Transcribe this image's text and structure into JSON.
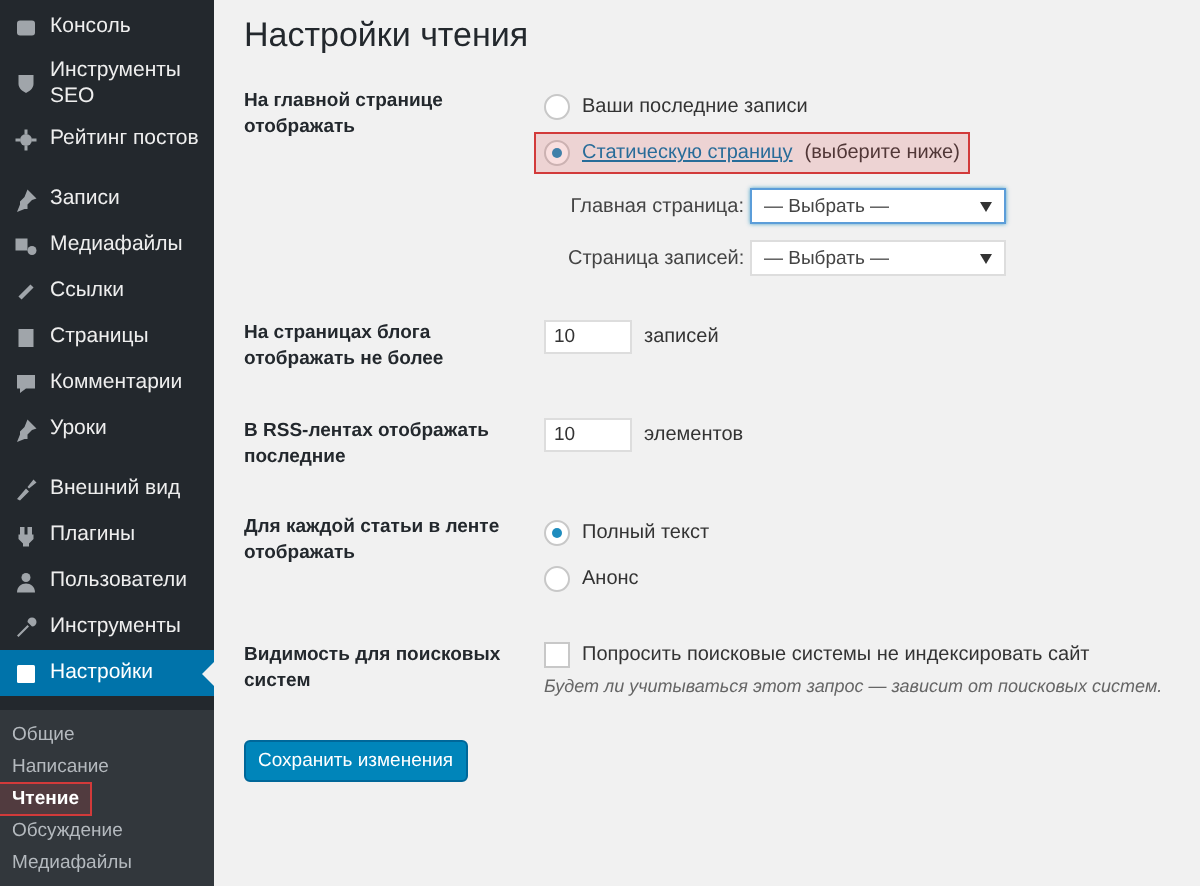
{
  "sidebar": {
    "groups": [
      [
        {
          "label": "Консоль",
          "selected": false
        },
        {
          "label": "Инструменты SEO",
          "selected": false
        },
        {
          "label": "Рейтинг постов",
          "selected": false
        }
      ],
      [
        {
          "label": "Записи",
          "selected": false
        },
        {
          "label": "Медиафайлы",
          "selected": false
        },
        {
          "label": "Ссылки",
          "selected": false
        },
        {
          "label": "Страницы",
          "selected": false
        },
        {
          "label": "Комментарии",
          "selected": false
        },
        {
          "label": "Уроки",
          "selected": false
        }
      ],
      [
        {
          "label": "Внешний вид",
          "selected": false
        },
        {
          "label": "Плагины",
          "selected": false
        },
        {
          "label": "Пользователи",
          "selected": false
        },
        {
          "label": "Инструменты",
          "selected": false
        },
        {
          "label": "Настройки",
          "selected": true
        }
      ]
    ],
    "submenu": [
      {
        "label": "Общие",
        "selected": false,
        "highlighted": false
      },
      {
        "label": "Написание",
        "selected": false,
        "highlighted": false
      },
      {
        "label": "Чтение",
        "selected": true,
        "highlighted": true
      },
      {
        "label": "Обсуждение",
        "selected": false,
        "highlighted": false
      },
      {
        "label": "Медиафайлы",
        "selected": false,
        "highlighted": false
      }
    ]
  },
  "page_title": "Настройки чтения",
  "settings": [
    {
      "kind": "radios",
      "label": "На главной странице отображать",
      "options": [
        {
          "label": "Ваши последние записи",
          "selected": false,
          "highlighted": false
        },
        {
          "link": "Статическую страницу",
          "label": "(выберите ниже)",
          "selected": true,
          "highlighted": true
        }
      ],
      "selects": [
        {
          "label": "Главная страница:",
          "value": "— Выбрать —",
          "focused": true
        },
        {
          "label": "Страница записей:",
          "value": "— Выбрать —",
          "focused": false
        }
      ]
    },
    {
      "kind": "number",
      "label": "На страницах блога отображать не более",
      "value": "10",
      "unit": "записей"
    },
    {
      "kind": "number",
      "label": "В RSS-лентах отображать последние",
      "value": "10",
      "unit": "элементов"
    },
    {
      "kind": "radios",
      "label": "Для каждой статьи в ленте отображать",
      "options": [
        {
          "label": "Полный текст",
          "selected": true,
          "highlighted": false
        },
        {
          "label": "Анонс",
          "selected": false,
          "highlighted": false
        }
      ]
    },
    {
      "kind": "checkbox",
      "label": "Видимость для поисковых систем",
      "checkbox_label": "Попросить поисковые системы не индексировать сайт",
      "checked": false,
      "note": "Будет ли учитываться этот запрос — зависит от поисковых систем."
    }
  ],
  "save_button": "Сохранить изменения"
}
